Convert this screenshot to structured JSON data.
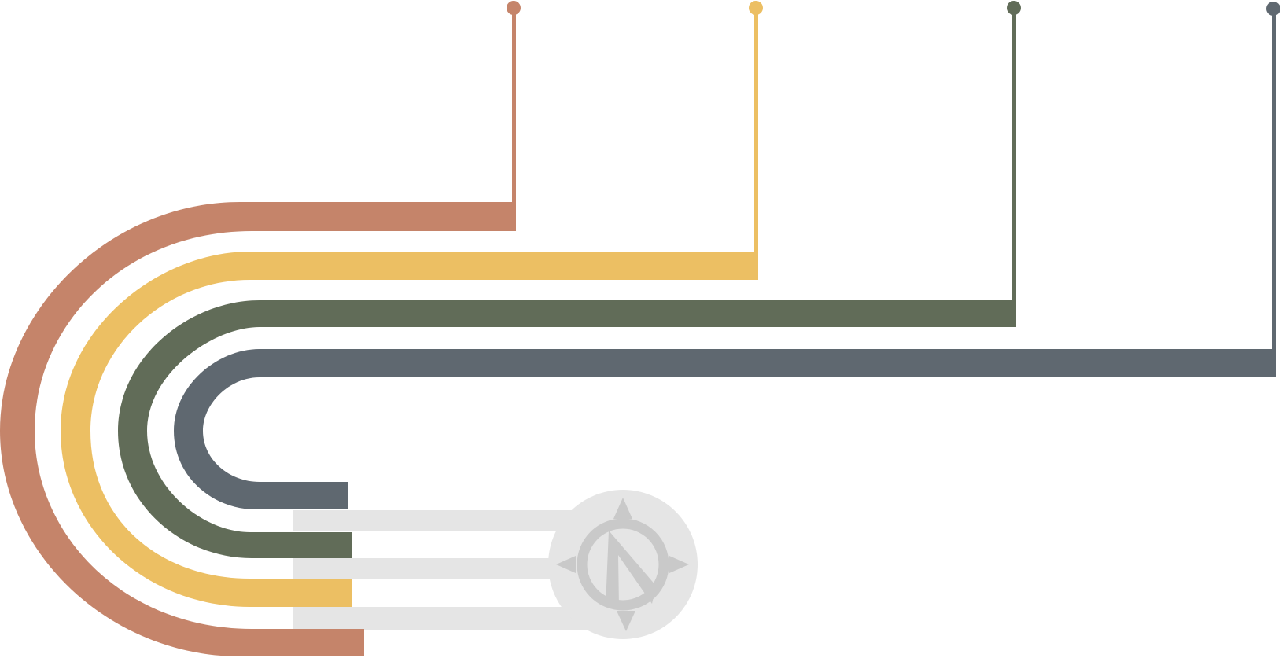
{
  "diagram": {
    "type": "nested-u-timeline-infographic",
    "bands": [
      {
        "order": 1,
        "color": "#C5846A",
        "pin": "pin-dot"
      },
      {
        "order": 2,
        "color": "#ECBF63",
        "pin": "pin-dot"
      },
      {
        "order": 3,
        "color": "#616C58",
        "pin": "pin-dot"
      },
      {
        "order": 4,
        "color": "#5F6870",
        "pin": "pin-dot"
      }
    ],
    "connector_color": "#E5E5E5",
    "compass": {
      "icon": "compass-icon",
      "disc_color": "#E5E5E5",
      "glyph_color": "#C9C9C9"
    }
  }
}
